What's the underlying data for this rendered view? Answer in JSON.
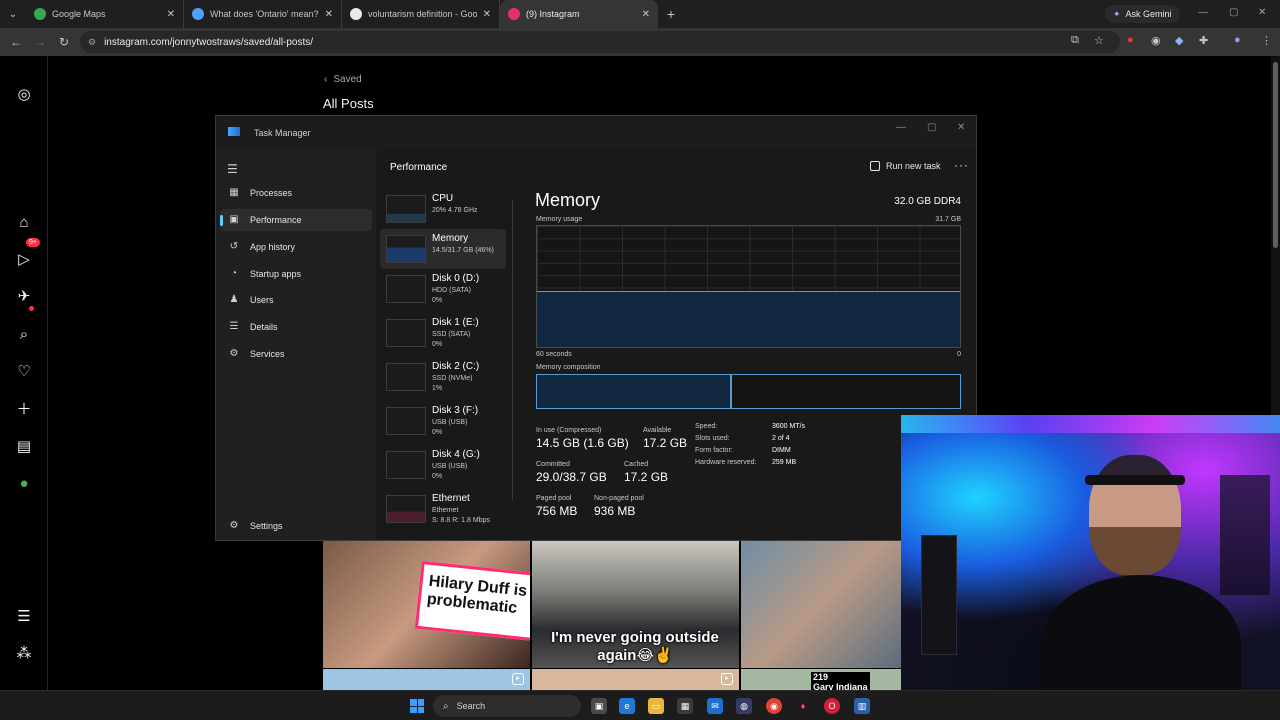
{
  "browser": {
    "tabs": [
      {
        "title": "Google Maps",
        "color": "#34a853"
      },
      {
        "title": "What does 'Ontario' mean? Sea",
        "color": "#4aa3ff"
      },
      {
        "title": "voluntarism definition - Google",
        "color": "#e8eaed"
      },
      {
        "title": "(9) Instagram",
        "color": "#e1306c"
      }
    ],
    "ask_gemini": "Ask Gemini",
    "url": "instagram.com/jonnytwostraws/saved/all-posts/"
  },
  "instagram": {
    "back_label": "Saved",
    "page_title": "All Posts",
    "notification_badge": "9+",
    "posts": [
      {
        "caption_line1": "Hilary Duff is",
        "caption_line2": "problematic"
      },
      {
        "caption_line1": "I'm never going outside",
        "caption_line2": "again😂✌️"
      },
      {
        "caption_line1": "",
        "caption_line2": ""
      }
    ],
    "row2_label": "219\nGary Indiana"
  },
  "task_manager": {
    "title": "Task Manager",
    "nav": [
      "Processes",
      "Performance",
      "App history",
      "Startup apps",
      "Users",
      "Details",
      "Services"
    ],
    "settings": "Settings",
    "header": "Performance",
    "run_new_task": "Run new task",
    "perf_items": [
      {
        "name": "CPU",
        "sub1": "20%  4.78 GHz",
        "sub2": ""
      },
      {
        "name": "Memory",
        "sub1": "14.5/31.7 GB (46%)",
        "sub2": ""
      },
      {
        "name": "Disk 0 (D:)",
        "sub1": "HDD (SATA)",
        "sub2": "0%"
      },
      {
        "name": "Disk 1 (E:)",
        "sub1": "SSD (SATA)",
        "sub2": "0%"
      },
      {
        "name": "Disk 2 (C:)",
        "sub1": "SSD (NVMe)",
        "sub2": "1%"
      },
      {
        "name": "Disk 3 (F:)",
        "sub1": "USB (USB)",
        "sub2": "0%"
      },
      {
        "name": "Disk 4 (G:)",
        "sub1": "USB (USB)",
        "sub2": "0%"
      },
      {
        "name": "Ethernet",
        "sub1": "Ethernet",
        "sub2": "S: 8.8  R: 1.8 Mbps"
      }
    ],
    "memory": {
      "title": "Memory",
      "spec": "32.0 GB DDR4",
      "usage_label": "Memory usage",
      "max_label": "31.7 GB",
      "time_label": "60 seconds",
      "zero_label": "0",
      "usage_fraction": 0.46,
      "composition_label": "Memory composition",
      "stats": {
        "in_use_label": "In use (Compressed)",
        "in_use": "14.5 GB (1.6 GB)",
        "available_label": "Available",
        "available": "17.2 GB",
        "committed_label": "Committed",
        "committed": "29.0/38.7 GB",
        "cached_label": "Cached",
        "cached": "17.2 GB",
        "paged_label": "Paged pool",
        "paged": "756 MB",
        "nonpaged_label": "Non-paged pool",
        "nonpaged": "936 MB"
      },
      "specs": [
        {
          "k": "Speed:",
          "v": "3600 MT/s"
        },
        {
          "k": "Slots used:",
          "v": "2 of 4"
        },
        {
          "k": "Form factor:",
          "v": "DIMM"
        },
        {
          "k": "Hardware reserved:",
          "v": "259 MB"
        }
      ]
    }
  },
  "taskbar": {
    "search": "Search"
  }
}
